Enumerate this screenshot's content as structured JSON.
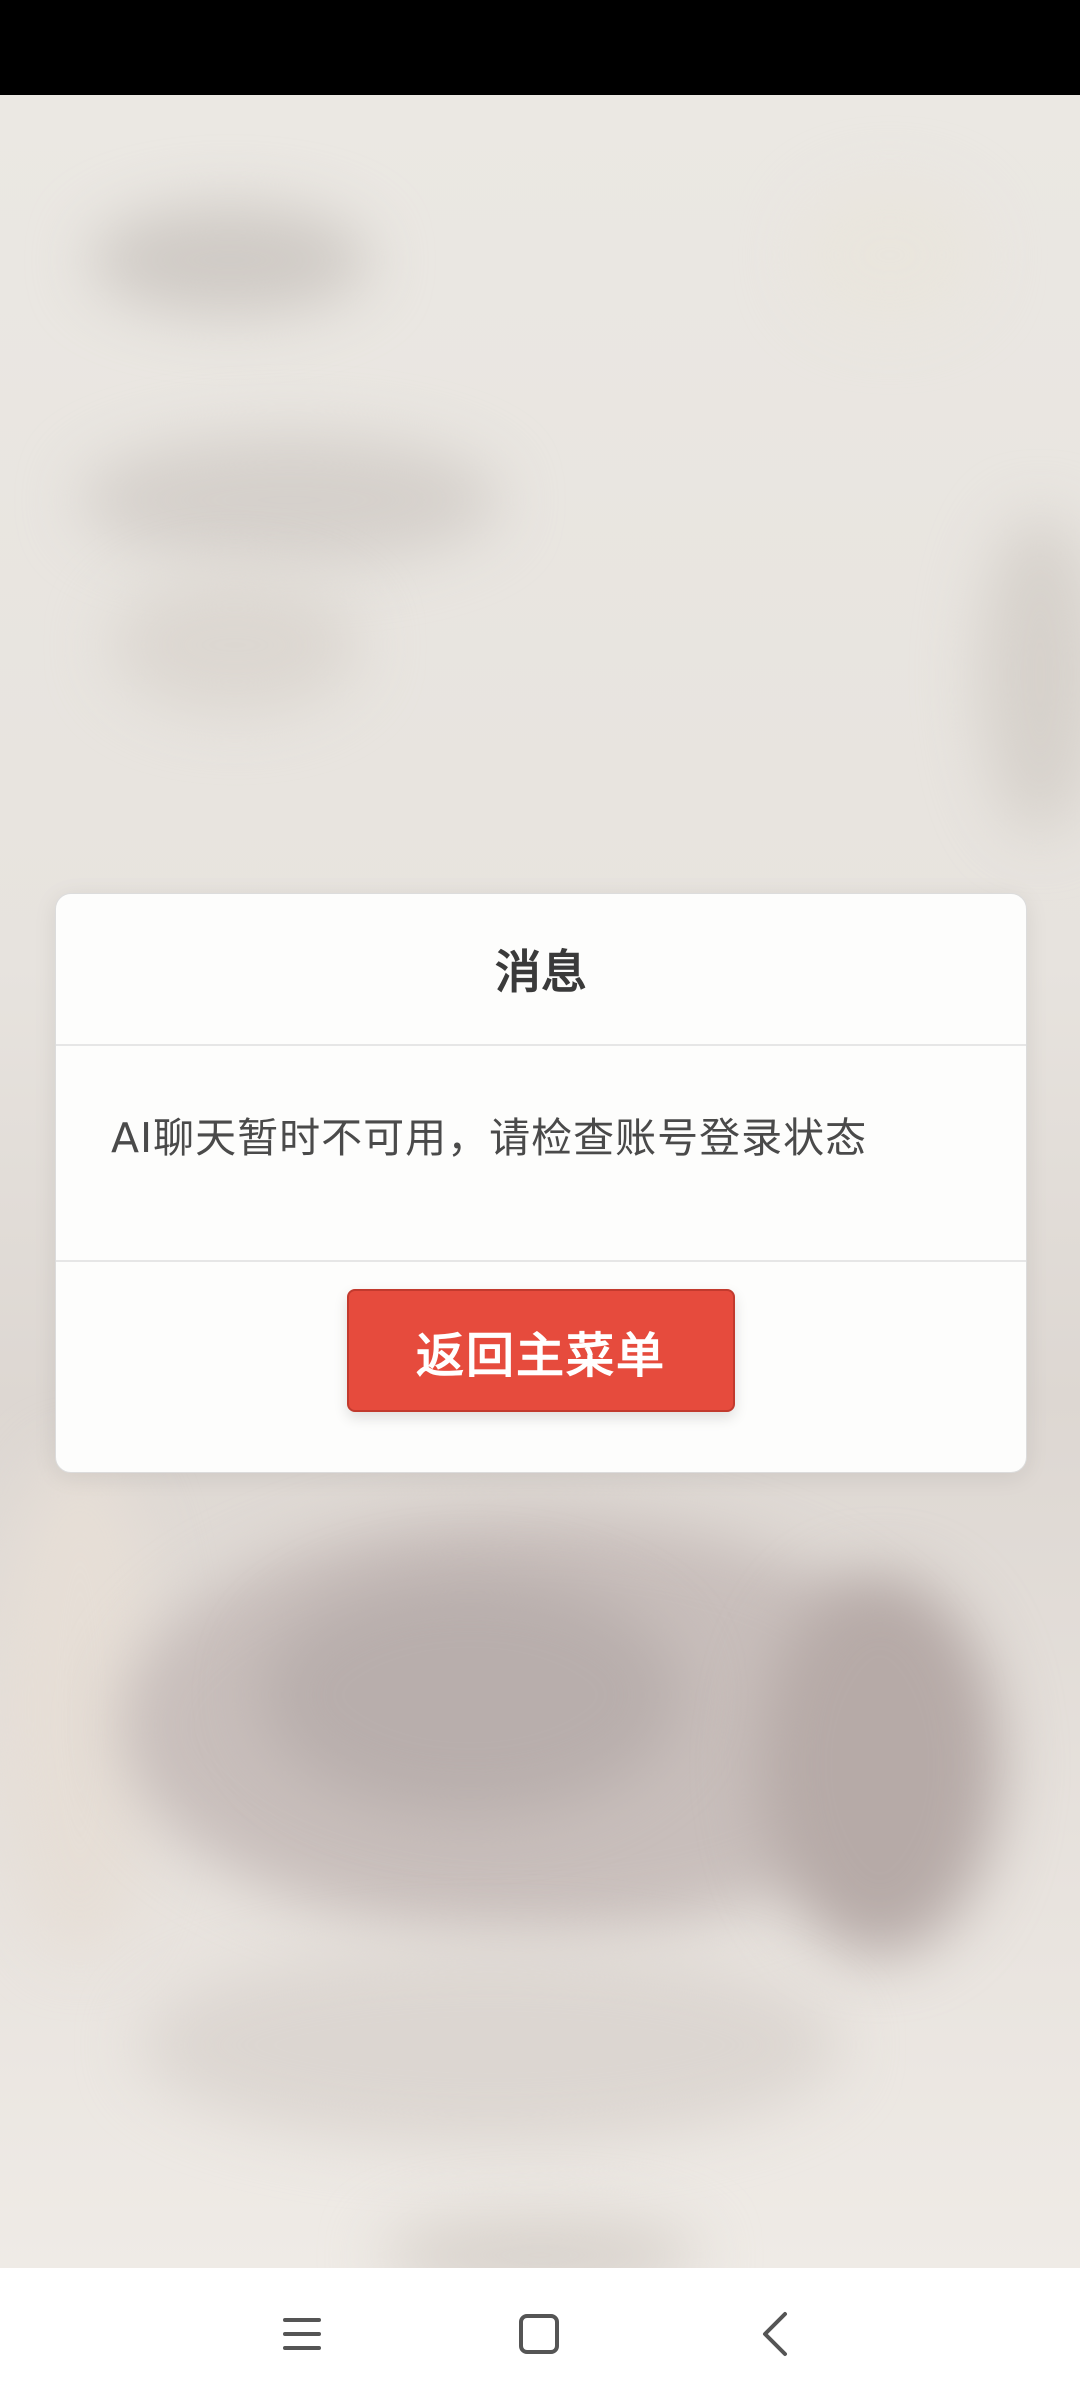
{
  "dialog": {
    "title": "消息",
    "message": "AI聊天暂时不可用，请检查账号登录状态",
    "button_label": "返回主菜单",
    "accent_color": "#e64b3d"
  },
  "nav_bar": {
    "icons": [
      "menu-icon",
      "home-square-icon",
      "back-chevron-icon"
    ]
  }
}
